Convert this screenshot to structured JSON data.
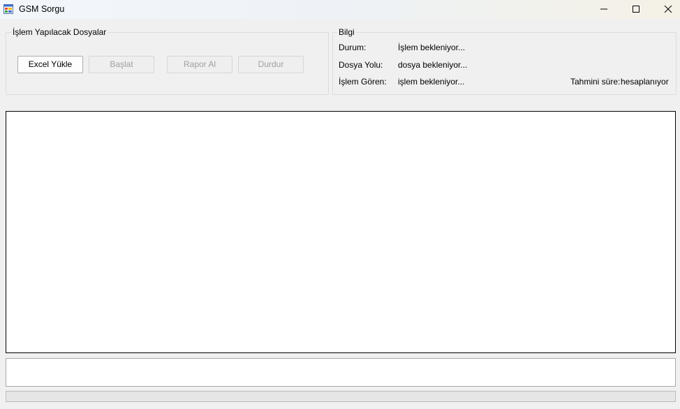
{
  "window": {
    "title": "GSM Sorgu",
    "icon": "app-form-icon",
    "controls": [
      "minimize-icon",
      "maximize-icon",
      "close-icon"
    ]
  },
  "files_group": {
    "legend": "İşlem Yapılacak Dosyalar",
    "buttons": {
      "excel": "Excel Yükle",
      "start": "Başlat",
      "report": "Rapor Al",
      "stop": "Durdur"
    }
  },
  "info_group": {
    "legend": "Bilgi",
    "status_label": "Durum:",
    "status_value": "İşlem bekleniyor...",
    "path_label": "Dosya Yolu:",
    "path_value": "dosya bekleniyor...",
    "processed_label": "İşlem Gören:",
    "processed_value": "işlem bekleniyor...",
    "eta_label": "Tahmini süre:",
    "eta_value": "hesaplanıyor"
  },
  "log": {
    "content": ""
  },
  "status_box": {
    "value": ""
  },
  "progress": {
    "value": 0
  }
}
